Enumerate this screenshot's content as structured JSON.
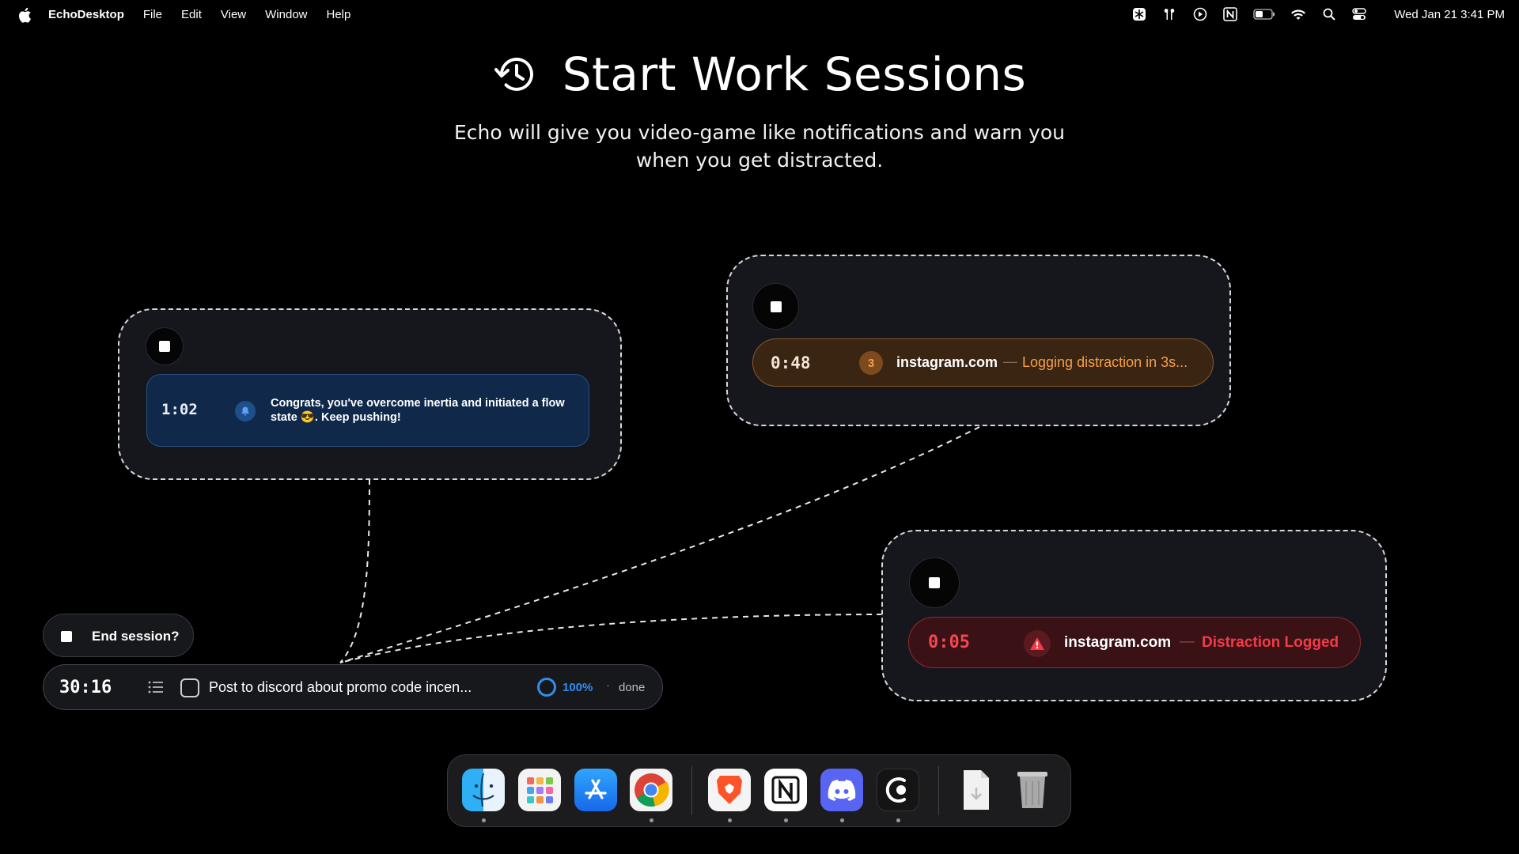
{
  "menubar": {
    "app_name": "EchoDesktop",
    "menus": [
      "File",
      "Edit",
      "View",
      "Window",
      "Help"
    ],
    "status_icons": [
      "perplexity-icon",
      "airpods-icon",
      "play-icon",
      "notion-icon",
      "battery-icon",
      "wifi-icon",
      "spotlight-search-icon",
      "control-center-icon"
    ],
    "clock": "Wed Jan 21  3:41 PM"
  },
  "hero": {
    "icon": "history-clock-icon",
    "title": "Start Work Sessions",
    "subtitle": "Echo will give you video-game like notifications and warn you when you get distracted."
  },
  "cards": {
    "flow": {
      "timer": "1:02",
      "icon": "bell-icon",
      "message": "Congrats, you've overcome inertia and initiated a flow state 😎. Keep pushing!",
      "accent": "#10294a"
    },
    "warning": {
      "timer": "0:48",
      "countdown": "3",
      "site": "instagram.com",
      "dash": "—",
      "status": "Logging distraction in 3s...",
      "accent": "#f4a04a"
    },
    "logged": {
      "timer": "0:05",
      "icon": "warning-triangle-icon",
      "site": "instagram.com",
      "dash": "—",
      "status": "Distraction Logged",
      "accent": "#f23b47"
    }
  },
  "session": {
    "end_label": "End session?",
    "timer": "30:16",
    "task": "Post to discord about promo code incen...",
    "progress_percent": 100,
    "progress_label": "100%",
    "separator": "·",
    "done_label": "done",
    "accent": "#2f8ff0"
  },
  "dock": {
    "apps": [
      {
        "name": "Finder",
        "icon": "finder-icon",
        "running": true
      },
      {
        "name": "Launchpad",
        "icon": "launchpad-icon",
        "running": false
      },
      {
        "name": "App Store",
        "icon": "app-store-icon",
        "running": false
      },
      {
        "name": "Google Chrome",
        "icon": "chrome-icon",
        "running": true
      },
      {
        "name": "Brave Browser",
        "icon": "brave-icon",
        "running": true
      },
      {
        "name": "Notion",
        "icon": "notion-icon",
        "running": true
      },
      {
        "name": "Discord",
        "icon": "discord-icon",
        "running": true
      },
      {
        "name": "EchoDesktop",
        "icon": "echo-icon",
        "running": true
      },
      {
        "name": "Downloads",
        "icon": "downloads-icon",
        "running": false
      },
      {
        "name": "Trash",
        "icon": "trash-icon",
        "running": false
      }
    ]
  }
}
